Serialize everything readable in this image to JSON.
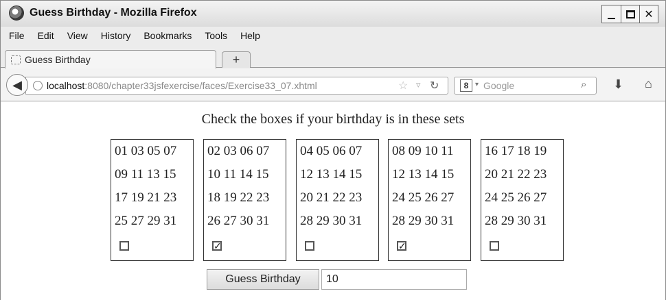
{
  "window": {
    "title": "Guess Birthday - Mozilla Firefox"
  },
  "menu": [
    {
      "label": "File"
    },
    {
      "label": "Edit"
    },
    {
      "label": "View"
    },
    {
      "label": "History"
    },
    {
      "label": "Bookmarks"
    },
    {
      "label": "Tools"
    },
    {
      "label": "Help"
    }
  ],
  "tab": {
    "label": "Guess Birthday",
    "new_tab": "+"
  },
  "nav": {
    "url_host": "localhost",
    "url_rest": ":8080/chapter33jsfexercise/faces/Exercise33_07.xhtml",
    "search_placeholder": "Google",
    "engine_icon": "8"
  },
  "page": {
    "heading": "Check the boxes if your birthday is in these sets",
    "cards": [
      {
        "lines": [
          "01 03 05 07",
          "09 11 13 15",
          "17 19 21 23",
          "25 27 29 31"
        ],
        "checked": false
      },
      {
        "lines": [
          "02 03 06 07",
          "10 11 14 15",
          "18 19 22 23",
          "26 27 30 31"
        ],
        "checked": true
      },
      {
        "lines": [
          "04 05 06 07",
          "12 13 14 15",
          "20 21 22 23",
          "28 29 30 31"
        ],
        "checked": false
      },
      {
        "lines": [
          "08 09 10 11",
          "12 13 14 15",
          "24 25 26 27",
          "28 29 30 31"
        ],
        "checked": true
      },
      {
        "lines": [
          "16 17 18 19",
          "20 21 22 23",
          "24 25 26 27",
          "28 29 30 31"
        ],
        "checked": false
      }
    ],
    "button_label": "Guess Birthday",
    "result_value": "10"
  }
}
